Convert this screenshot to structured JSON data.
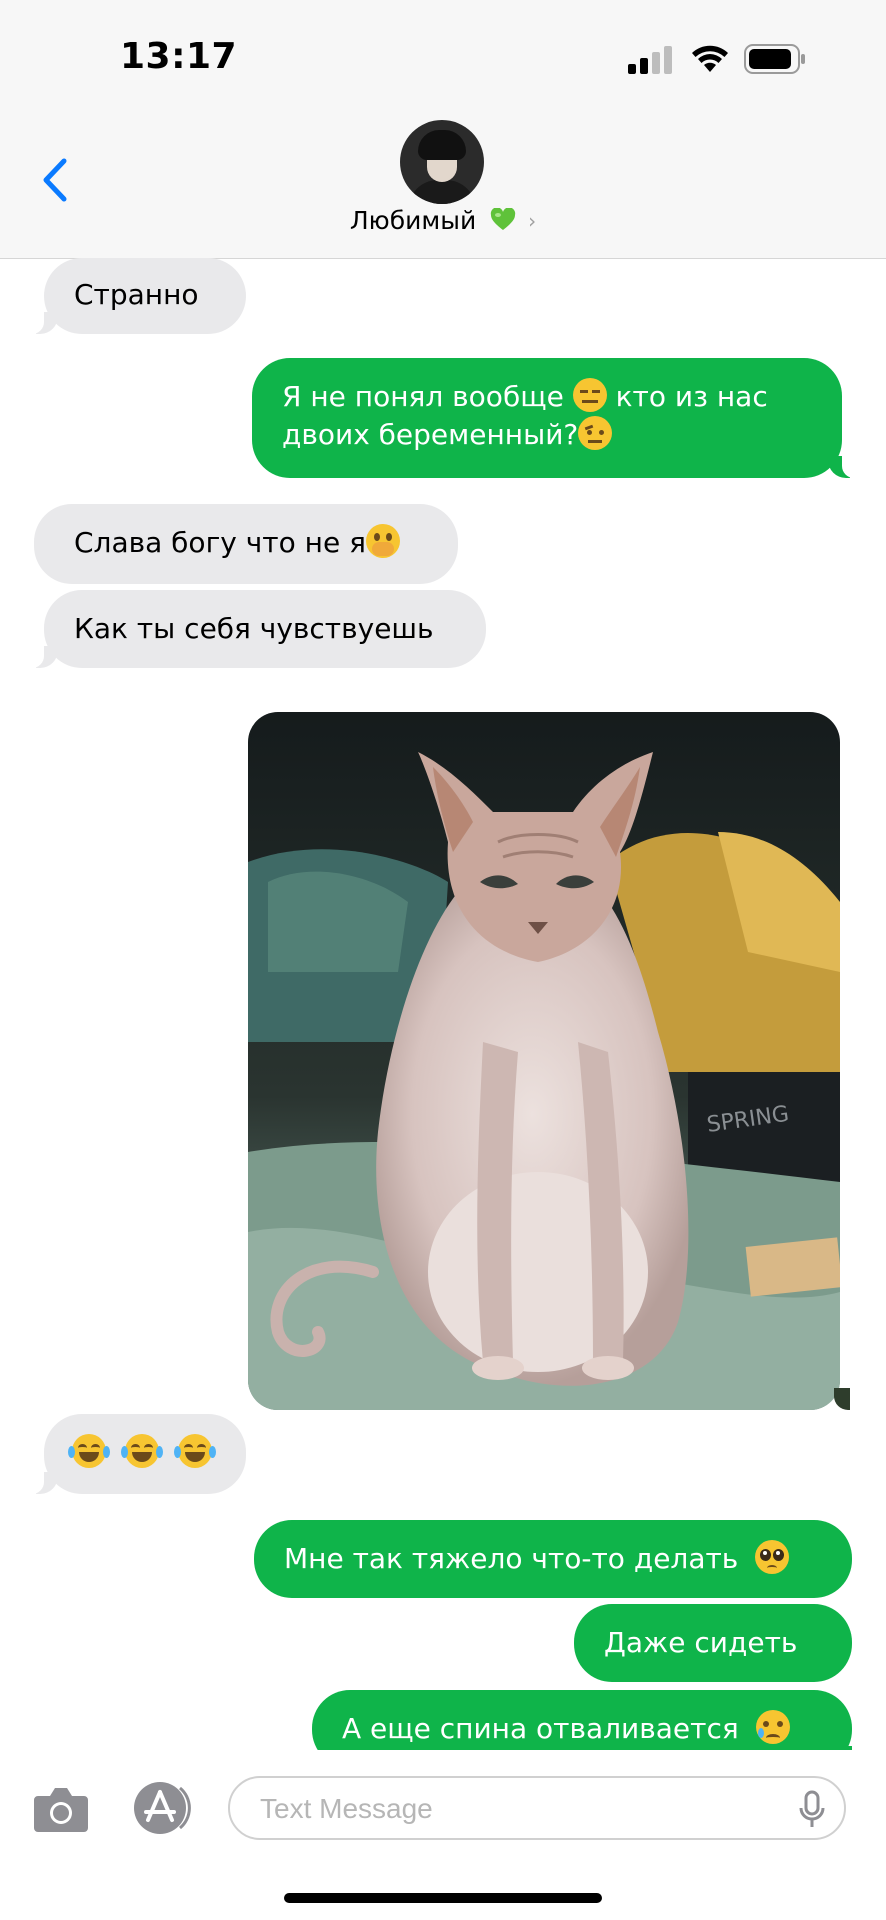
{
  "status_bar": {
    "time": "13:17",
    "signal_icon": "cellular-signal-icon",
    "wifi_icon": "wifi-icon",
    "battery_icon": "battery-icon"
  },
  "header": {
    "back_icon": "chevron-left-icon",
    "contact_name": "Любимый",
    "heart_icon": "green-heart-emoji",
    "chevron": "›"
  },
  "messages": [
    {
      "side": "in",
      "text": "Странно"
    },
    {
      "side": "out",
      "line1": "Я не понял вообще",
      "line1b": "кто из нас",
      "line2": "двоих беременный?"
    },
    {
      "side": "in",
      "text": "Слава богу что не я"
    },
    {
      "side": "in",
      "text": "Как ты себя чувствуешь"
    },
    {
      "side": "out",
      "type": "photo",
      "description": "pregnant-sphynx-cat-photo"
    },
    {
      "side": "in",
      "type": "emoji",
      "emojis": "tears-of-joy x3"
    },
    {
      "side": "out",
      "text": "Мне так тяжело что-то делать"
    },
    {
      "side": "out",
      "text": "Даже сидеть"
    },
    {
      "side": "out",
      "text": "А еще спина отваливается"
    }
  ],
  "input": {
    "placeholder": "Text Message",
    "value": ""
  },
  "colors": {
    "outgoing": "#0fb44a",
    "incoming": "#e9e9eb",
    "accent": "#0a7aff"
  }
}
